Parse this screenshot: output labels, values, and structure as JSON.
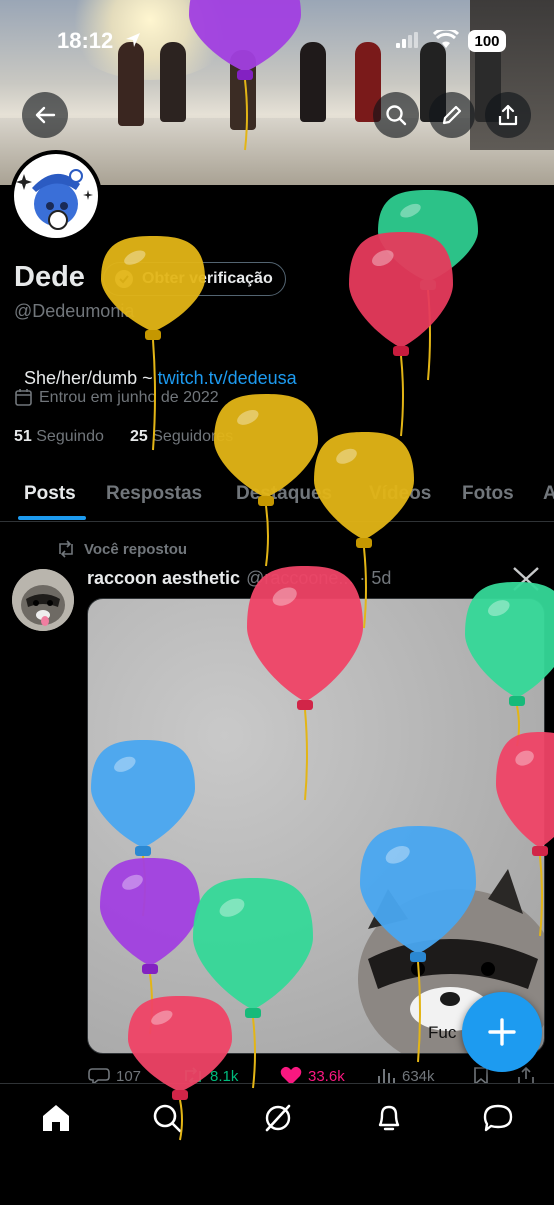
{
  "status_bar": {
    "time": "18:12",
    "battery": "100"
  },
  "profile": {
    "display_name": "Dede",
    "verify_label": "Obter verificação",
    "handle": "@Dedeumonia",
    "bio_text": "She/her/dumb ~ ",
    "bio_link": "twitch.tv/dedeusa",
    "joined": "Entrou em junho de 2022",
    "following_count": "51",
    "following_label": "Seguindo",
    "followers_count": "25",
    "followers_label": "Seguidores"
  },
  "tabs": [
    {
      "label": "Posts"
    },
    {
      "label": "Respostas"
    },
    {
      "label": "Destaques"
    },
    {
      "label": "Vídeos"
    },
    {
      "label": "Fotos"
    },
    {
      "label": "A"
    }
  ],
  "post": {
    "repost_label": "Você repostou",
    "author_name": "raccoon aesthetic",
    "author_handle": "@raccoone...",
    "time": "5d",
    "image_caption": "Fuc",
    "replies": "107",
    "reposts": "8.1k",
    "likes": "33.6k",
    "views": "634k"
  },
  "colors": {
    "accent": "#1d9bf0",
    "like": "#f91880",
    "repost": "#00ba7c",
    "muted": "#71767b"
  },
  "balloons": [
    {
      "color": "#a13fe0"
    },
    {
      "color": "#2ecc8f"
    },
    {
      "color": "#e63a5c"
    },
    {
      "color": "#e3b516"
    },
    {
      "color": "#e3b516"
    },
    {
      "color": "#e3b516"
    },
    {
      "color": "#ef4366"
    },
    {
      "color": "#35d898"
    },
    {
      "color": "#49a6f0"
    },
    {
      "color": "#ef4366"
    },
    {
      "color": "#a13fe0"
    },
    {
      "color": "#35d898"
    },
    {
      "color": "#49a6f0"
    },
    {
      "color": "#ef4366"
    }
  ]
}
